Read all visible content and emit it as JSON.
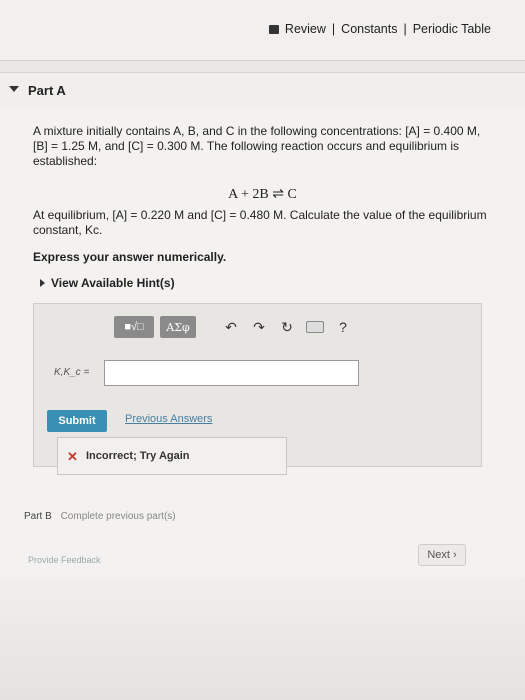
{
  "header": {
    "review": "Review",
    "sep1": "|",
    "constants": "Constants",
    "sep2": "|",
    "periodic": "Periodic Table"
  },
  "partA": {
    "title": "Part A",
    "problem_lines": [
      "A mixture initially contains A, B, and C in the following concentrations: [A] = 0.400 M,",
      "[B] = 1.25 M, and [C] = 0.300 M. The following reaction occurs and equilibrium is",
      "established:"
    ],
    "reaction": "A + 2B ⇌ C",
    "eq_lines": [
      "At equilibrium, [A] = 0.220 M and [C] = 0.480 M. Calculate the value of the equilibrium",
      "constant, Kc."
    ],
    "express": "Express your answer numerically.",
    "hints": "View Available Hint(s)"
  },
  "toolbar": {
    "templates": "■√□",
    "greek": "ΑΣφ",
    "undo": "↶",
    "redo": "↷",
    "reset": "↻",
    "help": "?"
  },
  "answer": {
    "label": "K,K_c =",
    "value": ""
  },
  "submit": "Submit",
  "previous": "Previous Answers",
  "feedback": "Incorrect; Try Again",
  "partB": {
    "label": "Part B",
    "text": "Complete previous part(s)"
  },
  "provide_feedback": "Provide Feedback",
  "next": "Next ›"
}
